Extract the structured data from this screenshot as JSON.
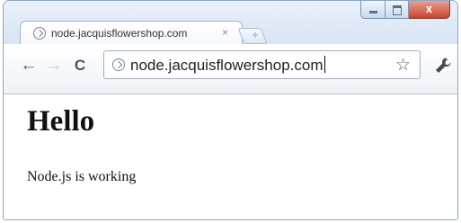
{
  "browser": {
    "tab": {
      "title": "node.jacquisflowershop.com",
      "favicon": "page-icon",
      "close_glyph": "×"
    },
    "new_tab_glyph": "+",
    "window_controls": {
      "minimize": "minimize-icon",
      "maximize": "maximize-icon",
      "close_glyph": "x"
    },
    "toolbar": {
      "back_glyph": "←",
      "forward_glyph": "→",
      "reload_glyph": "C",
      "url": "node.jacquisflowershop.com",
      "bookmark_glyph": "☆",
      "wrench_glyph": "🔧"
    }
  },
  "page": {
    "heading": "Hello",
    "paragraph": "Node.js is working"
  },
  "colors": {
    "frame": "#d7e4f4",
    "close_button": "#c8432d",
    "forward_disabled": "#c4c9d0"
  }
}
